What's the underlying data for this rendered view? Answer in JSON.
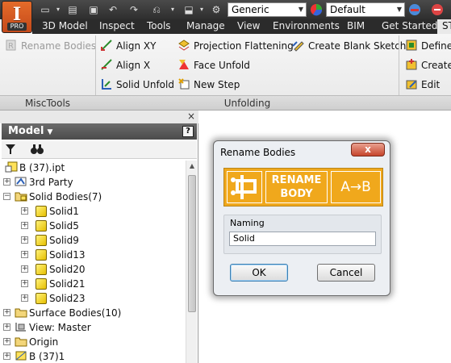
{
  "app": {
    "logo_letter": "I",
    "logo_badge": "PRO"
  },
  "quick_access": {
    "material_value": "Generic",
    "appearance_value": "Default"
  },
  "tabs": [
    "3D Model",
    "Inspect",
    "Tools",
    "Manage",
    "View",
    "Environments",
    "BIM",
    "Get Started",
    "ST"
  ],
  "ribbon": {
    "misc_tools": {
      "rename_bodies": "Rename Bodies",
      "panel_title": "MiscTools"
    },
    "unfolding": {
      "align_xy": "Align XY",
      "align_x": "Align X",
      "solid_unfold": "Solid Unfold",
      "projection_flattening": "Projection Flattening",
      "face_unfold": "Face Unfold",
      "new_step": "New Step",
      "create_blank_sketch": "Create Blank Sketch",
      "panel_title": "Unfolding"
    },
    "right": {
      "define": "Define",
      "create": "Create",
      "edit": "Edit"
    }
  },
  "browser": {
    "title": "Model",
    "close_glyph": "×",
    "help_glyph": "?",
    "tree": [
      {
        "label": "B (37).ipt"
      },
      {
        "label": "3rd Party"
      },
      {
        "label": "Solid Bodies(7)"
      },
      {
        "label": "Solid1"
      },
      {
        "label": "Solid5"
      },
      {
        "label": "Solid9"
      },
      {
        "label": "Solid13"
      },
      {
        "label": "Solid20"
      },
      {
        "label": "Solid21"
      },
      {
        "label": "Solid23"
      },
      {
        "label": "Surface Bodies(10)"
      },
      {
        "label": "View: Master"
      },
      {
        "label": "Origin"
      },
      {
        "label": "B (37)1"
      }
    ]
  },
  "dialog": {
    "title": "Rename Bodies",
    "close_glyph": "x",
    "banner": {
      "line1": "RENAME",
      "line2": "BODY",
      "arrow_text": "A→B"
    },
    "group_label": "Naming",
    "naming_value": "Solid",
    "ok_label": "OK",
    "cancel_label": "Cancel"
  },
  "colors": {
    "banner_orange": "#f0a81c",
    "logo_orange": "#e46b2a",
    "close_red": "#c6452c"
  }
}
